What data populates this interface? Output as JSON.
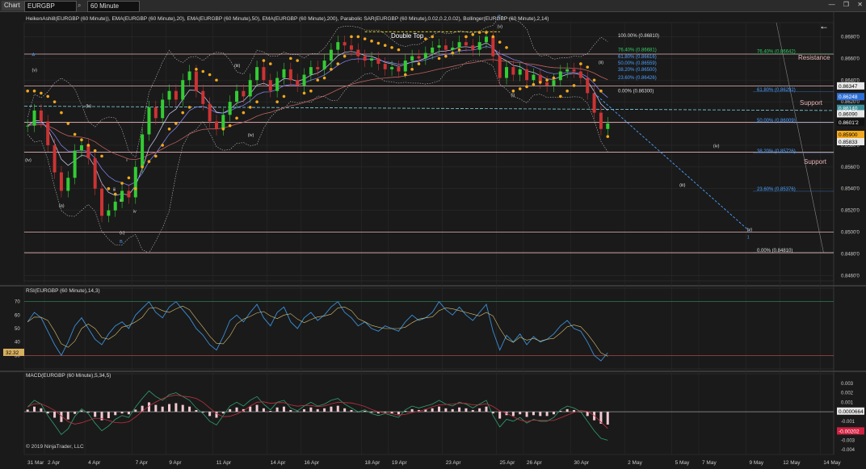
{
  "toolbar": {
    "chart_tab": "Chart",
    "symbol": "EURGBP",
    "timeframe": "60 Minute",
    "minimize": "—",
    "restore": "❐",
    "close": "✕",
    "back_arrow": "←",
    "search_icon": "search-icon"
  },
  "indicators_line": "HeikenAshi8(EURGBP (60 Minute)), EMA(EURGBP (60 Minute),20), EMA(EURGBP (60 Minute),50), EMA(EURGBP (60 Minute),200), Parabolic SAR(EURGBP (60 Minute),0.02,0.2,0.02), Bollinger(EURGBP (60 Minute),2,14)",
  "rsi_title": "RSI(EURGBP (60 Minute),14,3)",
  "macd_title": "MACD(EURGBP (60 Minute),5,34,5)",
  "copyright": "© 2019 NinjaTrader, LLC",
  "annotations": {
    "double_top": "Double Top",
    "resistance": "Resistance",
    "support1": "Support",
    "support2": "Support"
  },
  "colors": {
    "bg": "#1a1a1a",
    "bull": "#33cc33",
    "bear": "#cc3333",
    "sar": "#f2a81d",
    "ema": "#8a8aff",
    "hline": "#e8b4b8",
    "fib_blue": "#4aa0ff",
    "fib_green": "#33cc66",
    "cyan": "#7fd6e0"
  },
  "chart_data": {
    "type": "line",
    "price": {
      "y_ticks": [
        "0.8680'0",
        "0.8660'0",
        "0.8640'0",
        "0.8620'0",
        "0.8600'0",
        "0.8580'0",
        "0.8560'0",
        "0.8540'0",
        "0.8520'0",
        "0.8500'0",
        "0.8480'0",
        "0.8460'0"
      ],
      "ylim": [
        0.8455,
        0.8693
      ],
      "x_labels": [
        "31 Mar",
        "2 Apr",
        "4 Apr",
        "7 Apr",
        "9 Apr",
        "11 Apr",
        "14 Apr",
        "16 Apr",
        "18 Apr",
        "19 Apr",
        "23 Apr",
        "25 Apr",
        "26 Apr",
        "30 Apr",
        "2 May",
        "5 May",
        "7 May",
        "9 May",
        "12 May",
        "14 May"
      ],
      "x_positions": [
        0,
        3,
        9,
        16,
        21,
        28,
        36,
        41,
        50,
        54,
        62,
        70,
        74,
        81,
        89,
        96,
        100,
        107,
        112,
        118
      ],
      "n_slots": 120,
      "close": [
        0.8598,
        0.8612,
        0.8602,
        0.858,
        0.8555,
        0.8538,
        0.855,
        0.8575,
        0.858,
        0.8568,
        0.854,
        0.8515,
        0.852,
        0.8528,
        0.8538,
        0.8532,
        0.856,
        0.859,
        0.8615,
        0.8605,
        0.8622,
        0.863,
        0.8622,
        0.864,
        0.8648,
        0.863,
        0.8618,
        0.8602,
        0.8595,
        0.8608,
        0.862,
        0.863,
        0.8625,
        0.864,
        0.8652,
        0.864,
        0.863,
        0.8642,
        0.865,
        0.864,
        0.8635,
        0.8645,
        0.8652,
        0.865,
        0.8658,
        0.8668,
        0.8675,
        0.8672,
        0.8668,
        0.8662,
        0.8658,
        0.866,
        0.8655,
        0.865,
        0.8652,
        0.8648,
        0.8658,
        0.8662,
        0.866,
        0.8665,
        0.867,
        0.8672,
        0.8668,
        0.867,
        0.8675,
        0.8672,
        0.8668,
        0.8675,
        0.868,
        0.8662,
        0.8642,
        0.8652,
        0.8645,
        0.865,
        0.864,
        0.8645,
        0.8638,
        0.8635,
        0.864,
        0.8648,
        0.865,
        0.8648,
        0.8642,
        0.8628,
        0.861,
        0.8595,
        0.86
      ],
      "sar": [
        0.863,
        0.863,
        0.8628,
        0.8625,
        0.862,
        0.861,
        0.86,
        0.859,
        0.8585,
        0.858,
        0.8575,
        0.857,
        0.854,
        0.8535,
        0.8545,
        0.855,
        0.854,
        0.856,
        0.8565,
        0.857,
        0.858,
        0.8595,
        0.86,
        0.861,
        0.8615,
        0.865,
        0.8648,
        0.8645,
        0.864,
        0.8595,
        0.8598,
        0.8605,
        0.861,
        0.8615,
        0.862,
        0.8658,
        0.8655,
        0.862,
        0.8625,
        0.866,
        0.8658,
        0.8628,
        0.863,
        0.864,
        0.8642,
        0.865,
        0.8655,
        0.8662,
        0.868,
        0.868,
        0.8678,
        0.8676,
        0.8674,
        0.8672,
        0.867,
        0.8668,
        0.8645,
        0.865,
        0.8655,
        0.8678,
        0.868,
        0.866,
        0.8662,
        0.8665,
        0.8668,
        0.868,
        0.8682,
        0.8684,
        0.8684,
        0.868,
        0.8675,
        0.867,
        0.863,
        0.8632,
        0.8634,
        0.8636,
        0.8638,
        0.864,
        0.8642,
        0.8625,
        0.863,
        0.8635,
        0.8655,
        0.8652,
        0.864,
        0.863,
        0.8588
      ],
      "price_labels": [
        {
          "label": "0.86347",
          "value": 0.86347,
          "bg": "#e8e8e8",
          "fg": "#000"
        },
        {
          "label": "0.86248",
          "value": 0.86248,
          "bg": "#2d6fd6",
          "fg": "#fff"
        },
        {
          "label": "0.86140",
          "value": 0.8614,
          "bg": "#3a8f9a",
          "fg": "#fff"
        },
        {
          "label": "0.86090",
          "value": 0.8609,
          "bg": "#e8e8e8",
          "fg": "#000"
        },
        {
          "label": "0.8601'2",
          "value": 0.86012,
          "bg": "#111",
          "fg": "#fff"
        },
        {
          "label": "0.85900",
          "value": 0.859,
          "bg": "#f2a81d",
          "fg": "#000"
        },
        {
          "label": "0.85833",
          "value": 0.85833,
          "bg": "#e8e8e8",
          "fg": "#000"
        }
      ],
      "hlines": [
        0.8664,
        0.86347,
        0.86012,
        0.85736,
        0.85,
        0.8481
      ],
      "fib_top": [
        {
          "label": "100.00% (0.86810)",
          "value": 0.8681,
          "color": "#dddddd"
        },
        {
          "label": "76.40% (0.86681)",
          "value": 0.86681,
          "color": "#33cc66"
        },
        {
          "label": "61.80% (0.86616)",
          "value": 0.86616,
          "color": "#4aa0ff"
        },
        {
          "label": "50.00% (0.86559)",
          "value": 0.86559,
          "color": "#4aa0ff"
        },
        {
          "label": "38.20% (0.86500)",
          "value": 0.865,
          "color": "#4aa0ff"
        },
        {
          "label": "23.60% (0.86426)",
          "value": 0.86426,
          "color": "#4aa0ff"
        },
        {
          "label": "0.00% (0.86300)",
          "value": 0.863,
          "color": "#dddddd"
        }
      ],
      "fib_bottom": [
        {
          "label": "76.40% (0.86642)",
          "value": 0.86642,
          "color": "#33cc66"
        },
        {
          "label": "61.80% (0.86292)",
          "value": 0.86292,
          "color": "#4aa0ff"
        },
        {
          "label": "50.00% (0.86009)",
          "value": 0.86009,
          "color": "#4aa0ff"
        },
        {
          "label": "38.20% (0.85726)",
          "value": 0.85726,
          "color": "#4aa0ff"
        },
        {
          "label": "23.60% (0.85376)",
          "value": 0.85376,
          "color": "#4aa0ff"
        },
        {
          "label": "0.00% (0.84810)",
          "value": 0.8481,
          "color": "#dddddd"
        }
      ],
      "wave_labels": [
        {
          "label": "A",
          "slot": 1,
          "value": 0.8662,
          "color": "#4aa0ff"
        },
        {
          "label": "(v)",
          "slot": 1,
          "value": 0.8648,
          "color": "#ddd"
        },
        {
          "label": "(iv)",
          "slot": 0,
          "value": 0.8565,
          "color": "#ddd"
        },
        {
          "label": "(b)",
          "slot": 9,
          "value": 0.8615,
          "color": "#ddd"
        },
        {
          "label": "(a)",
          "slot": 5,
          "value": 0.8523,
          "color": "#ddd"
        },
        {
          "label": "i",
          "slot": 15,
          "value": 0.8565,
          "color": "#ddd"
        },
        {
          "label": "ii",
          "slot": 14,
          "value": 0.8528,
          "color": "#ddd"
        },
        {
          "label": "iii",
          "slot": 13,
          "value": 0.8538,
          "color": "#ddd"
        },
        {
          "label": "iv",
          "slot": 16,
          "value": 0.8518,
          "color": "#ddd"
        },
        {
          "label": "(c)",
          "slot": 14,
          "value": 0.8498,
          "color": "#ddd"
        },
        {
          "label": "B",
          "slot": 14,
          "value": 0.849,
          "color": "#4aa0ff"
        },
        {
          "label": "(iii)",
          "slot": 31,
          "value": 0.8652,
          "color": "#ddd"
        },
        {
          "label": "(iv)",
          "slot": 33,
          "value": 0.8588,
          "color": "#ddd"
        },
        {
          "label": "(v)",
          "slot": 70,
          "value": 0.8688,
          "color": "#ddd"
        },
        {
          "label": "C",
          "slot": 70,
          "value": 0.8697,
          "color": "#4aa0ff"
        },
        {
          "label": "(i)",
          "slot": 72,
          "value": 0.8625,
          "color": "#ddd"
        },
        {
          "label": "(ii)",
          "slot": 85,
          "value": 0.8655,
          "color": "#ddd"
        },
        {
          "label": "(iii)",
          "slot": 97,
          "value": 0.8542,
          "color": "#ddd"
        },
        {
          "label": "(iv)",
          "slot": 102,
          "value": 0.8578,
          "color": "#ddd"
        },
        {
          "label": "(v)",
          "slot": 107,
          "value": 0.8501,
          "color": "#ddd"
        },
        {
          "label": "1",
          "slot": 107,
          "value": 0.8494,
          "color": "#4aa0ff"
        }
      ]
    },
    "rsi": {
      "ylim": [
        20,
        80
      ],
      "y_ticks": [
        70,
        60,
        50,
        40,
        30
      ],
      "levels": [
        70,
        30
      ],
      "current_label": "32.32",
      "current": 32.32,
      "values": [
        55,
        62,
        58,
        48,
        38,
        30,
        40,
        52,
        58,
        50,
        42,
        38,
        46,
        52,
        55,
        50,
        60,
        65,
        70,
        62,
        58,
        66,
        70,
        64,
        58,
        50,
        45,
        38,
        34,
        44,
        56,
        60,
        55,
        62,
        68,
        58,
        52,
        62,
        66,
        55,
        50,
        58,
        62,
        56,
        60,
        66,
        70,
        62,
        58,
        52,
        55,
        50,
        48,
        52,
        50,
        48,
        55,
        60,
        56,
        58,
        62,
        70,
        64,
        60,
        66,
        60,
        56,
        62,
        68,
        48,
        34,
        45,
        40,
        46,
        38,
        44,
        40,
        42,
        46,
        52,
        56,
        50,
        48,
        40,
        30,
        26,
        32
      ]
    },
    "macd": {
      "ylim": [
        -0.0045,
        0.004
      ],
      "y_ticks": [
        0.003,
        0.002,
        0.001,
        0,
        -0.001,
        -0.002,
        -0.003,
        -0.004
      ],
      "y_labels": [
        "0.003",
        "0.002",
        "0.001",
        "0.0000664",
        "-0.001",
        "-0.00202",
        "-0.003",
        "-0.004"
      ],
      "current_label": "0.0000664",
      "current": 6.64e-05,
      "signal_label": "-0.00202",
      "signal": -0.00202,
      "values": [
        0.0005,
        0.0012,
        0.0008,
        -0.0004,
        -0.0014,
        -0.0024,
        -0.0018,
        -0.0005,
        0.0003,
        -0.0002,
        -0.0012,
        -0.002,
        -0.0015,
        -0.0008,
        -0.0004,
        -0.0006,
        0.0005,
        0.0014,
        0.0022,
        0.0016,
        0.0012,
        0.0018,
        0.002,
        0.0016,
        0.0012,
        0.0004,
        -0.0002,
        -0.001,
        -0.0014,
        -0.0004,
        0.0006,
        0.001,
        0.0006,
        0.0012,
        0.0016,
        0.0008,
        0.0002,
        0.001,
        0.0012,
        0.0004,
        0.0001,
        0.0006,
        0.001,
        0.0006,
        0.0008,
        0.0012,
        0.0014,
        0.0008,
        0.0004,
        0.0,
        0.0002,
        -0.0002,
        -0.0004,
        -0.0002,
        -0.0004,
        -0.0006,
        0.0002,
        0.0006,
        0.0004,
        0.0006,
        0.0008,
        0.0012,
        0.0008,
        0.0006,
        0.001,
        0.0008,
        0.0004,
        0.0008,
        0.0012,
        -0.0004,
        -0.0016,
        -0.0008,
        -0.001,
        -0.0006,
        -0.0012,
        -0.0008,
        -0.001,
        -0.001,
        -0.0006,
        0.0002,
        0.0006,
        0.0004,
        0.0,
        -0.001,
        -0.002,
        -0.0028,
        -0.003
      ]
    }
  }
}
